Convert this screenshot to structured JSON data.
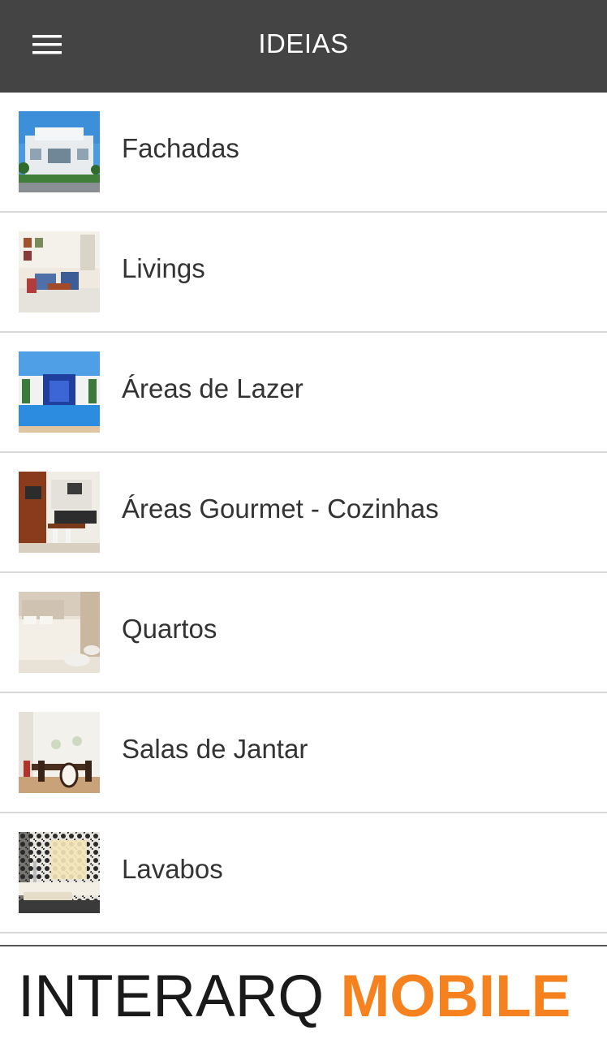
{
  "appbar": {
    "title": "IDEIAS",
    "menu_icon": "hamburger-menu-icon",
    "background": "#444444"
  },
  "items": [
    {
      "label": "Fachadas",
      "image": "house-facade-photo"
    },
    {
      "label": "Livings",
      "image": "living-room-photo"
    },
    {
      "label": "Áreas de Lazer",
      "image": "pool-area-photo"
    },
    {
      "label": "Áreas Gourmet - Cozinhas",
      "image": "gourmet-kitchen-photo"
    },
    {
      "label": "Quartos",
      "image": "bedroom-photo"
    },
    {
      "label": "Salas de Jantar",
      "image": "dining-room-photo"
    },
    {
      "label": "Lavabos",
      "image": "washroom-photo"
    }
  ],
  "footer": {
    "brand_left": "INTERARQ",
    "brand_right": "MOBILE",
    "brand_left_color": "#1a1a1a",
    "brand_right_color": "#f5821f"
  }
}
